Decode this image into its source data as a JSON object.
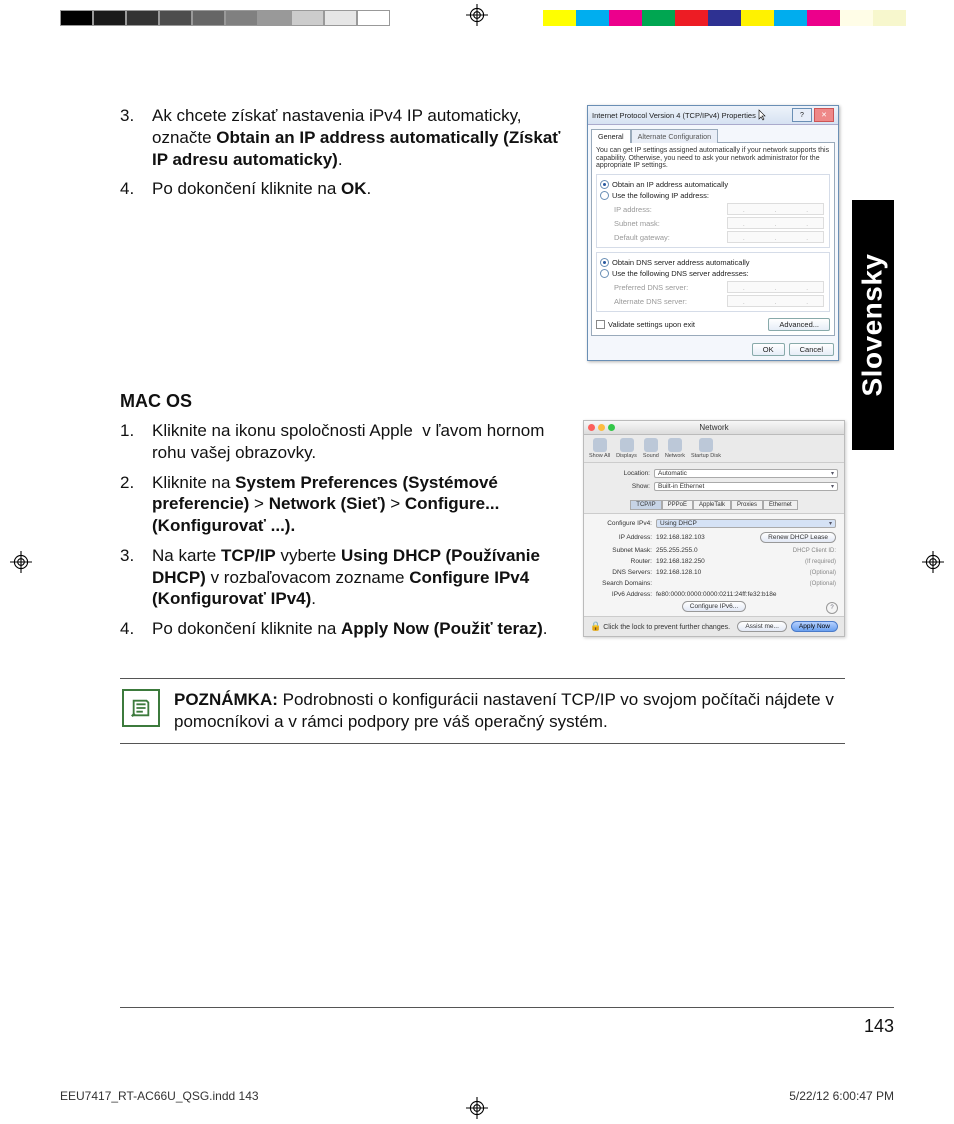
{
  "calibration": {
    "gray_steps": [
      "#000000",
      "#1a1a1a",
      "#333333",
      "#4d4d4d",
      "#666666",
      "#808080",
      "#999999",
      "#cccccc",
      "#e6e6e6",
      "#ffffff"
    ],
    "color_steps": [
      "#ffff00",
      "#00aeef",
      "#ec008c",
      "#00a651",
      "#ed1c24",
      "#2e3192",
      "#fff200",
      "#00adee",
      "#ec008b",
      "#fffde7",
      "#f7f7cd"
    ]
  },
  "language_tab": "Slovensky",
  "section1": {
    "items": [
      {
        "num": "3.",
        "html": "Ak chcete získať nastavenia iPv4 IP automaticky, označte <b>Obtain an IP address automatically (Získať IP adresu automaticky)</b>."
      },
      {
        "num": "4.",
        "html": "Po dokončení kliknite na <b>OK</b>."
      }
    ]
  },
  "windows_dialog": {
    "title": "Internet Protocol Version 4 (TCP/IPv4) Properties",
    "tabs": [
      "General",
      "Alternate Configuration"
    ],
    "desc": "You can get IP settings assigned automatically if your network supports this capability. Otherwise, you need to ask your network administrator for the appropriate IP settings.",
    "ip_auto": "Obtain an IP address automatically",
    "ip_manual": "Use the following IP address:",
    "ip_fields": [
      "IP address:",
      "Subnet mask:",
      "Default gateway:"
    ],
    "dns_auto": "Obtain DNS server address automatically",
    "dns_manual": "Use the following DNS server addresses:",
    "dns_fields": [
      "Preferred DNS server:",
      "Alternate DNS server:"
    ],
    "validate": "Validate settings upon exit",
    "advanced": "Advanced...",
    "ok": "OK",
    "cancel": "Cancel"
  },
  "mac_heading": "MAC OS",
  "mac_steps": {
    "items": [
      {
        "num": "1.",
        "pre": "Kliknite na ikonu spoločnosti Apple ",
        "post": " v ľavom hornom rohu vašej obrazovky."
      },
      {
        "num": "2.",
        "html": "Kliknite na <b>System Preferences (Systémové preferencie)</b> > <b>Network (Sieť)</b> > <b>Configure... (Konfigurovať ...).</b>"
      },
      {
        "num": "3.",
        "html": "Na karte <b>TCP/IP</b> vyberte <b>Using DHCP (Používanie DHCP)</b> v rozbaľovacom zozname <b>Configure IPv4 (Konfigurovať IPv4)</b>."
      },
      {
        "num": "4.",
        "html": "Po dokončení kliknite na  <b>Apply Now (Použiť teraz)</b>."
      }
    ]
  },
  "mac_dialog": {
    "title": "Network",
    "toolbar": [
      "Show All",
      "Displays",
      "Sound",
      "Network",
      "Startup Disk"
    ],
    "location_lbl": "Location:",
    "location": "Automatic",
    "show_lbl": "Show:",
    "show": "Built-in Ethernet",
    "tabs": [
      "TCP/IP",
      "PPPoE",
      "AppleTalk",
      "Proxies",
      "Ethernet"
    ],
    "configure_lbl": "Configure IPv4:",
    "configure": "Using DHCP",
    "rows": [
      {
        "lbl": "IP Address:",
        "val": "192.168.182.103",
        "btn": "Renew DHCP Lease"
      },
      {
        "lbl": "Subnet Mask:",
        "val": "255.255.255.0",
        "extra_lbl": "DHCP Client ID:"
      },
      {
        "lbl": "Router:",
        "val": "192.168.182.250",
        "hint": "(If required)"
      },
      {
        "lbl": "DNS Servers:",
        "val": "192.168.128.10",
        "opt": "(Optional)"
      },
      {
        "lbl": "Search Domains:",
        "val": "",
        "opt": "(Optional)"
      },
      {
        "lbl": "IPv6 Address:",
        "val": "fe80:0000:0000:0000:0211:24ff:fe32:b18e"
      }
    ],
    "configure_ipv6": "Configure IPv6...",
    "lock_text": "Click the lock to prevent further changes.",
    "assist": "Assist me...",
    "apply": "Apply Now"
  },
  "note": {
    "label": "POZNÁMKA:",
    "text": "   Podrobnosti o konfigurácii nastavení TCP/IP vo svojom počítači nájdete v pomocníkovi a v rámci podpory pre váš operačný systém."
  },
  "page_number": "143",
  "slug_left": "EEU7417_RT-AC66U_QSG.indd   143",
  "slug_right": "5/22/12   6:00:47 PM"
}
